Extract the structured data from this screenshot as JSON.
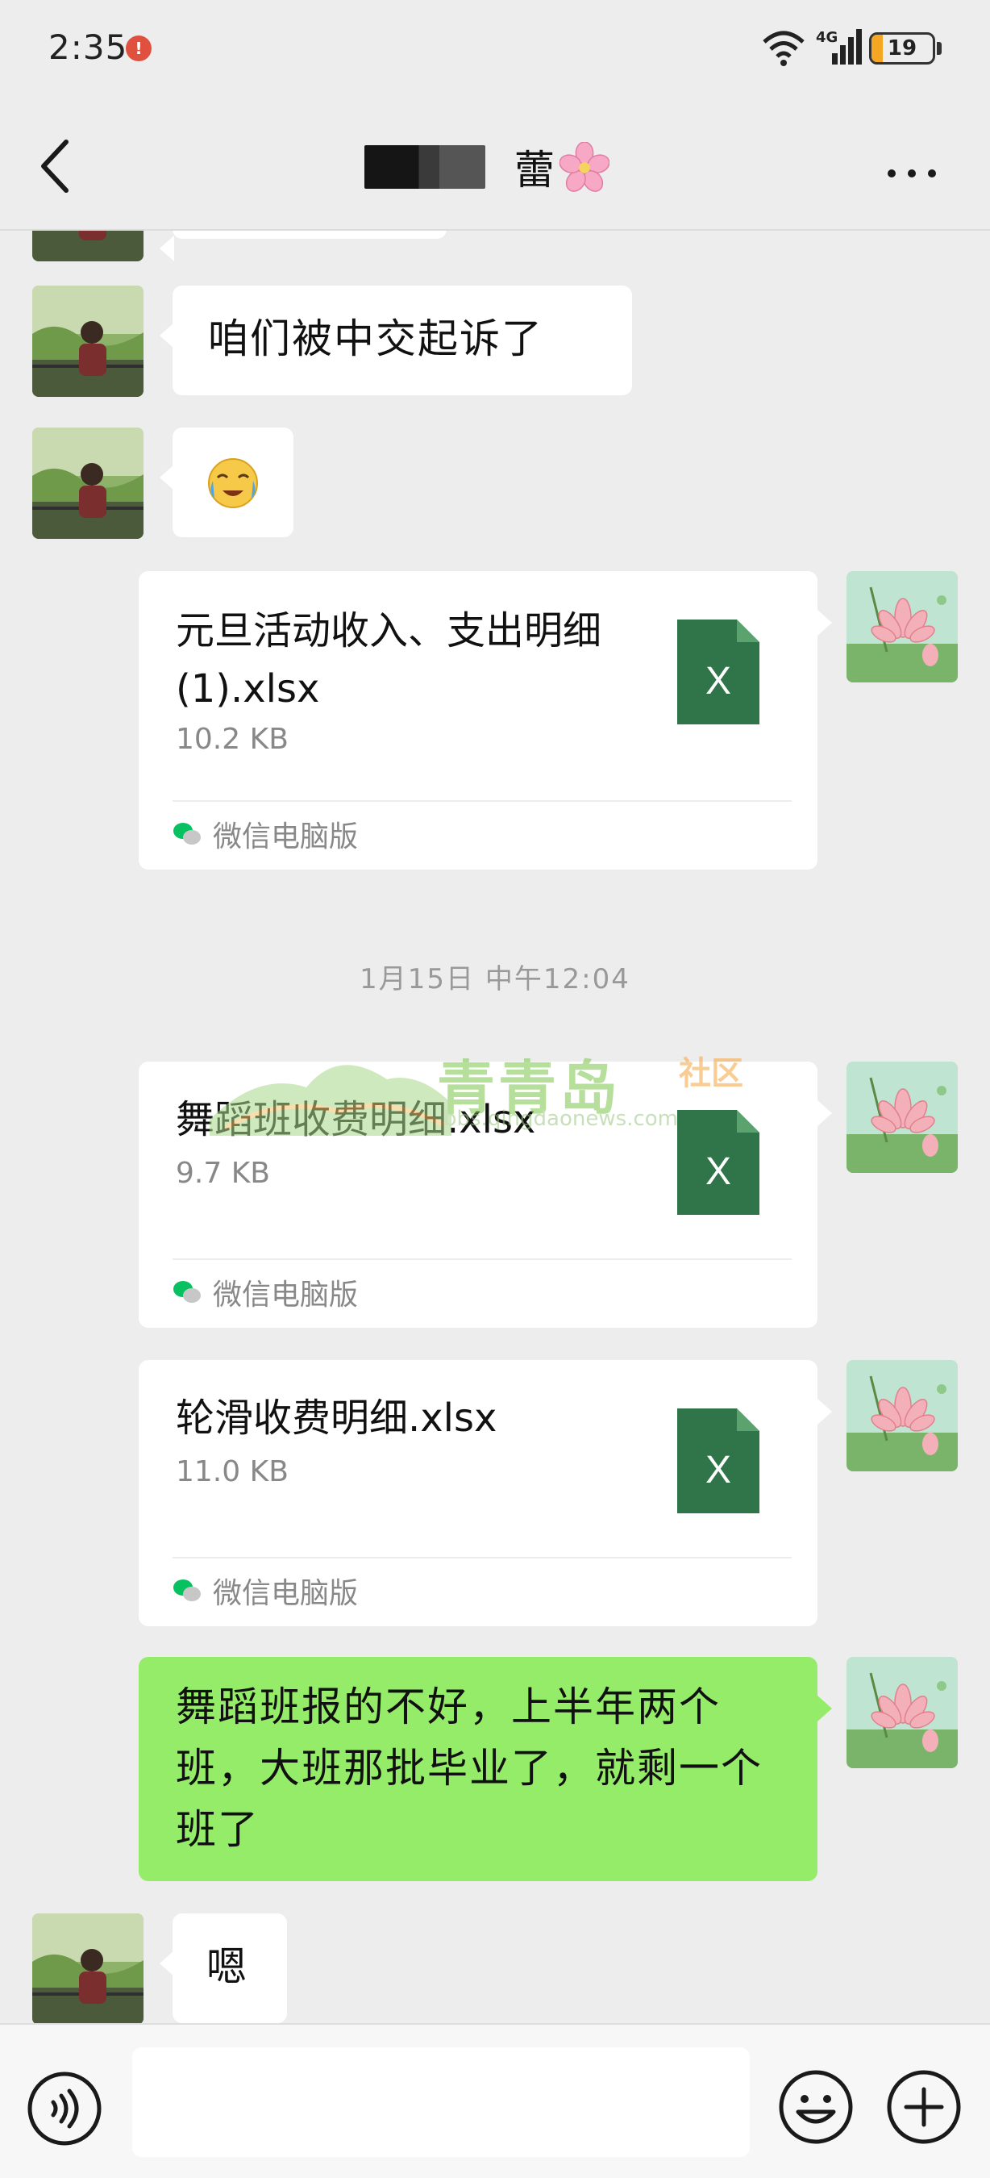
{
  "status_bar": {
    "time": "2:35",
    "alert_badge": "!",
    "network_label": "4G",
    "battery_level": 19,
    "battery_text": "19"
  },
  "header": {
    "title": "蕾",
    "back_icon": "chevron-left-icon",
    "more_icon": "more-dots-icon"
  },
  "colors": {
    "background": "#ededed",
    "outgoing_bubble": "#95ec69",
    "incoming_bubble": "#ffffff",
    "excel_green": "#2f7549",
    "wechat_green": "#07c160"
  },
  "messages": [
    {
      "type": "text",
      "side": "left",
      "text": "咱们被中交起诉了"
    },
    {
      "type": "emoji",
      "side": "left",
      "emoji": "😭"
    },
    {
      "type": "file",
      "side": "right",
      "name": "元旦活动收入、支出明细(1).xlsx",
      "size": "10.2 KB",
      "source": "微信电脑版"
    },
    {
      "type": "timestamp",
      "text": "1月15日 中午12:04"
    },
    {
      "type": "file",
      "side": "right",
      "name": "舞蹈班收费明细.xlsx",
      "size": "9.7 KB",
      "source": "微信电脑版"
    },
    {
      "type": "file",
      "side": "right",
      "name": "轮滑收费明细.xlsx",
      "size": "11.0 KB",
      "source": "微信电脑版"
    },
    {
      "type": "text",
      "side": "right",
      "text": "舞蹈班报的不好，上半年两个班，大班那批毕业了，就剩一个班了"
    },
    {
      "type": "text",
      "side": "left",
      "text": "嗯"
    }
  ],
  "watermark": {
    "name": "青青岛",
    "suffix": "社区",
    "url": "bbs.qingdaonews.com"
  },
  "input_bar": {
    "placeholder": "",
    "voice_icon": "voice-icon",
    "emoji_icon": "emoji-icon",
    "plus_icon": "plus-icon"
  }
}
